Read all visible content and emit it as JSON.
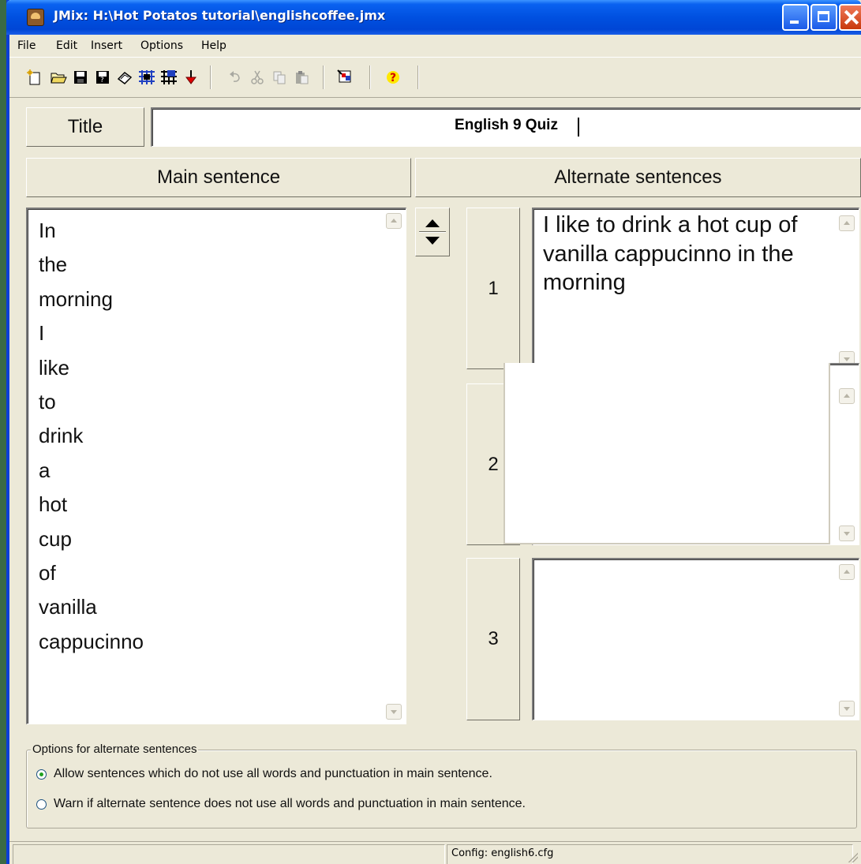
{
  "window": {
    "title": "JMix: H:\\Hot Potatos tutorial\\englishcoffee.jmx"
  },
  "menu": {
    "items": [
      "File",
      "Edit",
      "Insert",
      "Options",
      "Help"
    ]
  },
  "toolbar": {
    "icons": [
      "new-file-icon",
      "open-folder-icon",
      "save-icon",
      "save-as-icon",
      "eraser-icon",
      "create-web-page-icon",
      "create-web-page-v6-icon",
      "export-icon",
      "undo-icon",
      "cut-icon",
      "copy-icon",
      "paste-icon",
      "masher-icon",
      "help-icon"
    ]
  },
  "title_field": {
    "label": "Title",
    "value": "English 9 Quiz"
  },
  "main_sentence": {
    "header": "Main sentence",
    "words": [
      "In",
      "the",
      "morning",
      "I",
      "like",
      "to",
      "drink",
      "a",
      "hot",
      "cup",
      "of",
      "vanilla",
      "cappucinno"
    ]
  },
  "alternate_sentences": {
    "header": "Alternate sentences",
    "items": [
      {
        "number": "1",
        "text": "I like to drink a hot cup of vanilla cappucinno in the morning"
      },
      {
        "number": "2",
        "text": ""
      },
      {
        "number": "3",
        "text": ""
      }
    ]
  },
  "options": {
    "legend": "Options for alternate sentences",
    "allow_label": "Allow sentences which do not use all words and punctuation in main sentence.",
    "warn_label": "Warn if alternate sentence does not use all words and punctuation in main sentence.",
    "selected": "allow"
  },
  "status": {
    "config": "Config: english6.cfg"
  },
  "colors": {
    "title_bar": "#0050e0",
    "window_bg": "#ece9d8",
    "desktop": "#3a6a45"
  }
}
